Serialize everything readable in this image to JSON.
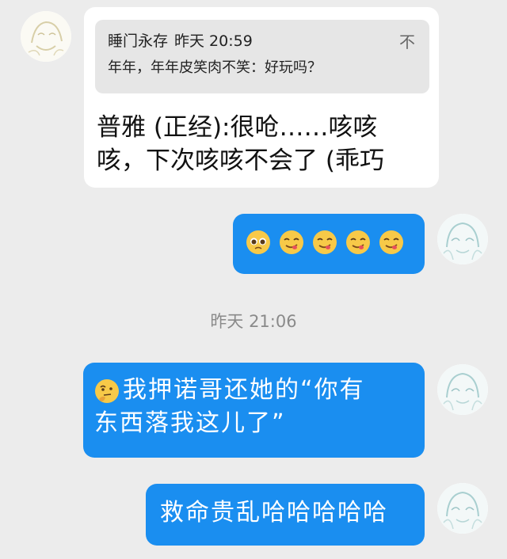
{
  "chat": {
    "messages": [
      {
        "quote": {
          "sender": "睡门永存",
          "time": "昨天 20:59",
          "text": "年年，年年皮笑肉不笑：好玩吗？",
          "close": "不"
        },
        "text_line1": "普雅 (正经):很呛……咳咳",
        "text_line2": "咳，下次咳咳不会了 (乖巧"
      },
      {
        "emoji": [
          "pleading-face",
          "yum-face",
          "yum-face",
          "yum-face",
          "yum-face"
        ]
      },
      {
        "timestamp": "昨天 21:06"
      },
      {
        "leading_emoji": "thinking-face",
        "text_line1": "我押诺哥还她的“你有",
        "text_line2": "东西落我这儿了”"
      },
      {
        "text": "救命贵乱哈哈哈哈哈"
      }
    ]
  },
  "colors": {
    "background": "#ececec",
    "incoming_bubble": "#ffffff",
    "outgoing_bubble": "#1a8ef0",
    "quote_background": "#e6e6e6",
    "timestamp_text": "#8a8a8a"
  }
}
